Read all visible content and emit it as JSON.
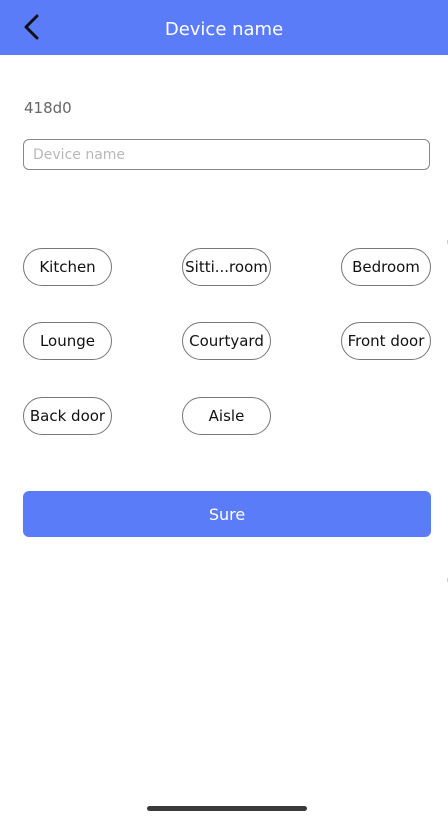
{
  "header": {
    "title": "Device name",
    "back_icon": "chevron-left-icon",
    "background_color": "#5b7cf9"
  },
  "device": {
    "id": "418d0"
  },
  "name_field": {
    "value": "",
    "placeholder": "Device name"
  },
  "presets": [
    {
      "label": "Kitchen"
    },
    {
      "label": "Sitti...room"
    },
    {
      "label": "Bedroom"
    },
    {
      "label": "Lounge"
    },
    {
      "label": "Courtyard"
    },
    {
      "label": "Front door"
    },
    {
      "label": "Back door"
    },
    {
      "label": "Aisle"
    }
  ],
  "actions": {
    "sure_label": "Sure",
    "accent_color": "#5b7cf9"
  }
}
